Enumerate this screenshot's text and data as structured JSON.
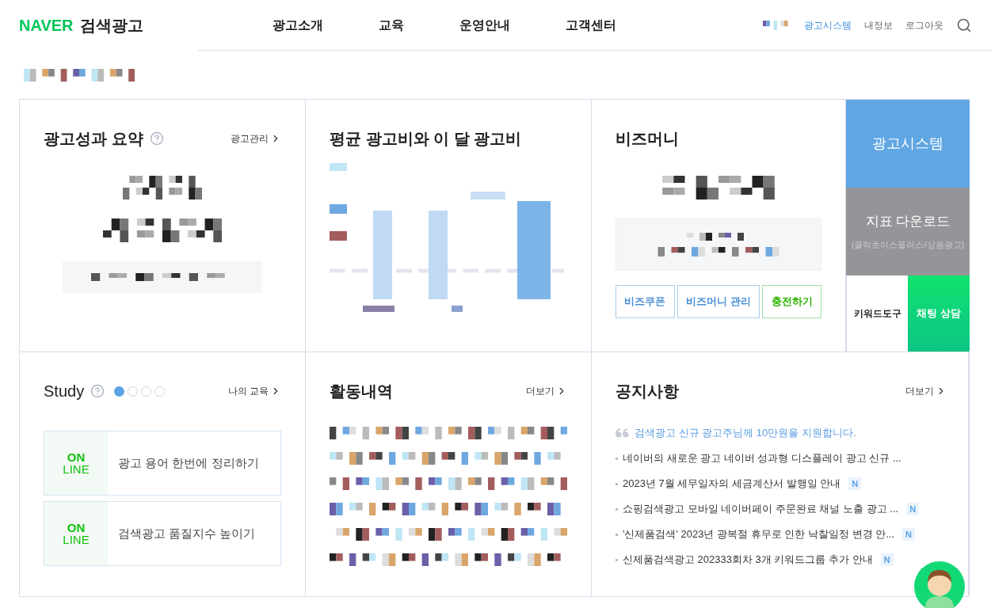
{
  "header": {
    "logo_brand": "NAVER",
    "logo_service": "검색광고",
    "nav": [
      "광고소개",
      "교육",
      "운영안내",
      "고객센터"
    ],
    "links": [
      {
        "label": "광고시스템",
        "selected": true
      },
      {
        "label": "내정보",
        "selected": false
      },
      {
        "label": "로그아웃",
        "selected": false
      }
    ]
  },
  "summary": {
    "title": "광고성과 요약",
    "link": "광고관리"
  },
  "spend": {
    "title": "평균 광고비와 이 달 광고비"
  },
  "bizmoney": {
    "title": "비즈머니",
    "buttons": [
      {
        "label": "비즈쿠폰",
        "kind": "blue"
      },
      {
        "label": "비즈머니 관리",
        "kind": "blue"
      },
      {
        "label": "충전하기",
        "kind": "green"
      }
    ]
  },
  "side": {
    "system": "광고시스템",
    "download": "지표 다운로드",
    "download_note": "(클릭초이스플러스/상품광고)",
    "keyword_tool": "키워드도구",
    "chat": "채팅 상담"
  },
  "study": {
    "title": "Study",
    "dots": [
      {
        "selected": true
      },
      {
        "selected": false
      },
      {
        "selected": false
      },
      {
        "selected": false
      }
    ],
    "link": "나의 교육",
    "courses": [
      {
        "badge_top": "ON",
        "badge_bottom": "LINE",
        "title": "광고 용어 한번에 정리하기"
      },
      {
        "badge_top": "ON",
        "badge_bottom": "LINE",
        "title": "검색광고 품질지수 높이기"
      }
    ]
  },
  "activity": {
    "title": "활동내역",
    "link": "더보기"
  },
  "notices": {
    "title": "공지사항",
    "link": "더보기",
    "items": [
      {
        "kind": "quote",
        "text": "검색광고 신규 광고주님께 10만원을 지원합니다.",
        "new": false
      },
      {
        "kind": "bullet",
        "text": "네이버의 새로운 광고 네이버 성과형 디스플레이 광고 신규 ...",
        "new": false
      },
      {
        "kind": "bullet",
        "text": "2023년 7월 세무일자의 세금계산서 발행일 안내",
        "new": true,
        "new_label": "N"
      },
      {
        "kind": "bullet",
        "text": "쇼핑검색광고 모바일 네이버페이 주문완료 채널 노출 광고 ...",
        "new": true,
        "new_label": "N"
      },
      {
        "kind": "bullet",
        "text": "'신제품검색' 2023년 광복절 휴무로 인한 낙찰일정 변경 안...",
        "new": true,
        "new_label": "N"
      },
      {
        "kind": "bullet",
        "text": "신제품검색광고 202333회차 3개 키워드그룹 추가 안내",
        "new": true,
        "new_label": "N"
      }
    ]
  }
}
